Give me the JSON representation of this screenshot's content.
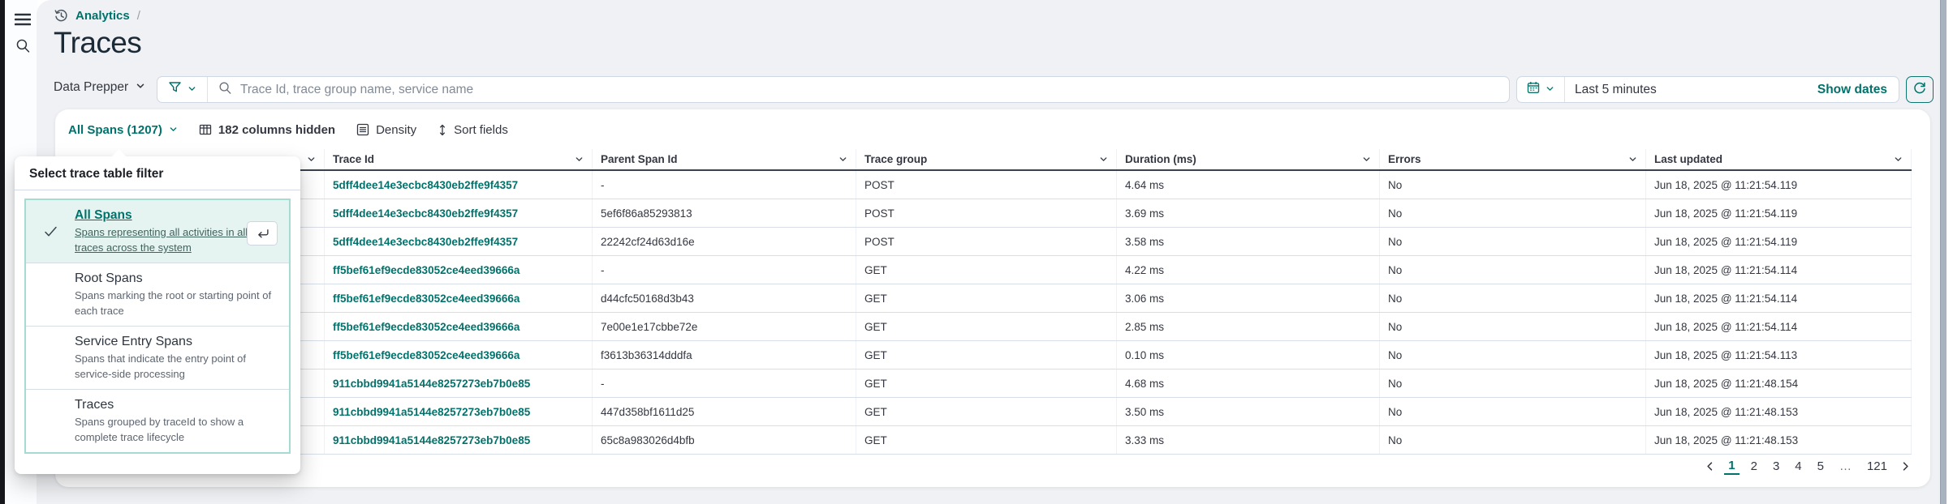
{
  "colors": {
    "primary_teal": "#00726b",
    "text_dark": "#343741",
    "selected_option_bg": "#e6f4f1",
    "panel_border_teal": "#a5dbd3",
    "page_bg": "#eff1f4",
    "header_underline": "#39414d"
  },
  "sidebar": {
    "icons": [
      "menu-icon",
      "search-icon"
    ]
  },
  "breadcrumb": {
    "icon": "history-icon",
    "label": "Analytics",
    "separator": "/"
  },
  "page": {
    "title": "Traces"
  },
  "toolbar": {
    "dataset_label": "Data Prepper",
    "filter_icon": "funnel-icon",
    "search_placeholder": "Trace Id, trace group name, service name",
    "calendar_icon": "calendar-icon",
    "time_range": "Last 5 minutes",
    "show_dates_label": "Show dates",
    "refresh_icon": "refresh-icon"
  },
  "table_toolbar": {
    "filter_label": "All Spans (1207)",
    "columns_hidden_label": "182 columns hidden",
    "density_label": "Density",
    "sort_fields_label": "Sort fields"
  },
  "filter_popover": {
    "title": "Select trace table filter",
    "options": [
      {
        "title": "All Spans",
        "description": "Spans representing all activities in all traces across the system",
        "selected": true
      },
      {
        "title": "Root Spans",
        "description": "Spans marking the root or starting point of each trace",
        "selected": false
      },
      {
        "title": "Service Entry Spans",
        "description": "Spans that indicate the entry point of service-side processing",
        "selected": false
      },
      {
        "title": "Traces",
        "description": "Spans grouped by traceId to show a complete trace lifecycle",
        "selected": false
      }
    ]
  },
  "table": {
    "columns": [
      "Trace Id",
      "Parent Span Id",
      "Trace group",
      "Duration (ms)",
      "Errors",
      "Last updated"
    ],
    "rows": [
      {
        "trace_id": "5dff4dee14e3ecbc8430eb2ffe9f4357",
        "parent_span_id": "-",
        "trace_group": "POST",
        "duration": "4.64 ms",
        "errors": "No",
        "last_updated": "Jun 18, 2025 @ 11:21:54.119"
      },
      {
        "trace_id": "5dff4dee14e3ecbc8430eb2ffe9f4357",
        "parent_span_id": "5ef6f86a85293813",
        "trace_group": "POST",
        "duration": "3.69 ms",
        "errors": "No",
        "last_updated": "Jun 18, 2025 @ 11:21:54.119"
      },
      {
        "trace_id": "5dff4dee14e3ecbc8430eb2ffe9f4357",
        "parent_span_id": "22242cf24d63d16e",
        "trace_group": "POST",
        "duration": "3.58 ms",
        "errors": "No",
        "last_updated": "Jun 18, 2025 @ 11:21:54.119"
      },
      {
        "trace_id": "ff5bef61ef9ecde83052ce4eed39666a",
        "parent_span_id": "-",
        "trace_group": "GET",
        "duration": "4.22 ms",
        "errors": "No",
        "last_updated": "Jun 18, 2025 @ 11:21:54.114"
      },
      {
        "trace_id": "ff5bef61ef9ecde83052ce4eed39666a",
        "parent_span_id": "d44cfc50168d3b43",
        "trace_group": "GET",
        "duration": "3.06 ms",
        "errors": "No",
        "last_updated": "Jun 18, 2025 @ 11:21:54.114"
      },
      {
        "trace_id": "ff5bef61ef9ecde83052ce4eed39666a",
        "parent_span_id": "7e00e1e17cbbe72e",
        "trace_group": "GET",
        "duration": "2.85 ms",
        "errors": "No",
        "last_updated": "Jun 18, 2025 @ 11:21:54.114"
      },
      {
        "trace_id": "ff5bef61ef9ecde83052ce4eed39666a",
        "parent_span_id": "f3613b36314dddfa",
        "trace_group": "GET",
        "duration": "0.10 ms",
        "errors": "No",
        "last_updated": "Jun 18, 2025 @ 11:21:54.113"
      },
      {
        "trace_id": "911cbbd9941a5144e8257273eb7b0e85",
        "parent_span_id": "-",
        "trace_group": "GET",
        "duration": "4.68 ms",
        "errors": "No",
        "last_updated": "Jun 18, 2025 @ 11:21:48.154"
      },
      {
        "trace_id": "911cbbd9941a5144e8257273eb7b0e85",
        "parent_span_id": "447d358bf1611d25",
        "trace_group": "GET",
        "duration": "3.50 ms",
        "errors": "No",
        "last_updated": "Jun 18, 2025 @ 11:21:48.153"
      },
      {
        "trace_id": "911cbbd9941a5144e8257273eb7b0e85",
        "parent_span_id": "65c8a983026d4bfb",
        "trace_group": "GET",
        "duration": "3.33 ms",
        "errors": "No",
        "last_updated": "Jun 18, 2025 @ 11:21:48.153"
      }
    ]
  },
  "pagination": {
    "pages": [
      "1",
      "2",
      "3",
      "4",
      "5",
      "…",
      "121"
    ],
    "active": "1",
    "prev_icon": "chevron-left-icon",
    "next_icon": "chevron-right-icon"
  }
}
